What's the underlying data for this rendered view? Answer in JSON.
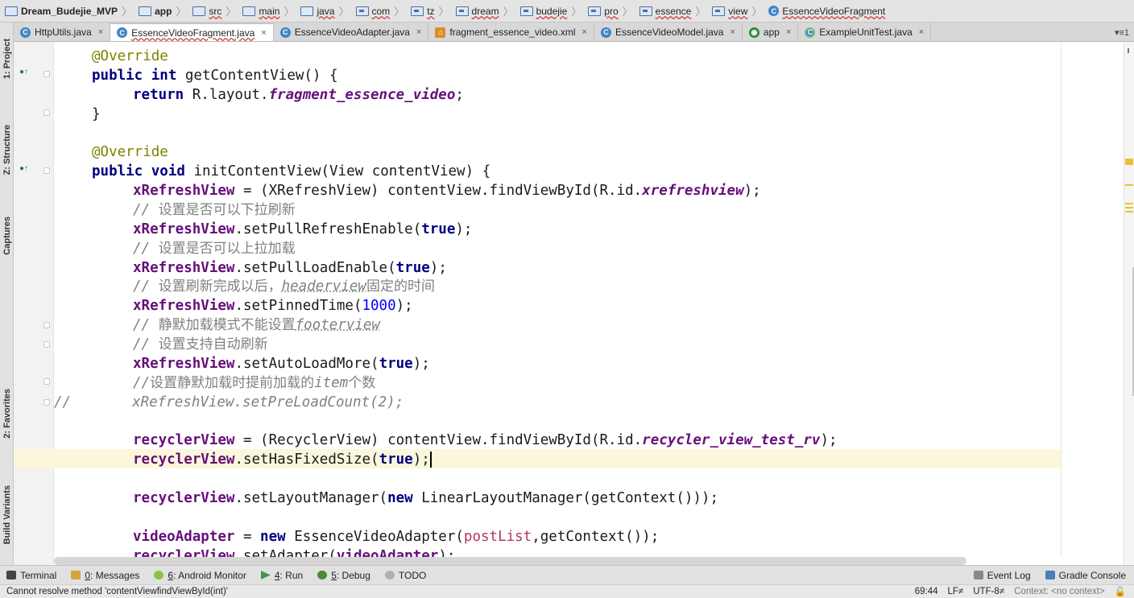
{
  "breadcrumbs": [
    "Dream_Budejie_MVP",
    "app",
    "src",
    "main",
    "java",
    "com",
    "tz",
    "dream",
    "budejie",
    "pro",
    "essence",
    "view",
    "EssenceVideoFragment"
  ],
  "tabs": [
    {
      "label": "HttpUtils.java",
      "icon": "class-icon"
    },
    {
      "label": "EssenceVideoFragment.java",
      "icon": "class-icon",
      "active": true
    },
    {
      "label": "EssenceVideoAdapter.java",
      "icon": "class-icon"
    },
    {
      "label": "fragment_essence_video.xml",
      "icon": "xml-icon"
    },
    {
      "label": "EssenceVideoModel.java",
      "icon": "class-icon"
    },
    {
      "label": "app",
      "icon": "android-app-icon"
    },
    {
      "label": "ExampleUnitTest.java",
      "icon": "test-class-icon"
    }
  ],
  "tab_close_glyph": "×",
  "tabs_overflow": "▾≡1",
  "left_tools": [
    "1: Project",
    "Z: Structure",
    "Captures",
    "2: Favorites",
    "Build Variants"
  ],
  "code": {
    "l1": "@Override",
    "l2a": "public int",
    "l2b": " getContentView() {",
    "l3a": "return",
    "l3b": " R.layout.",
    "l3c": "fragment_essence_video",
    "l3d": ";",
    "l4": "}",
    "l6": "@Override",
    "l7a": "public void",
    "l7b": " initContentView(View contentView) {",
    "l8a": "xRefreshView",
    "l8b": " = (XRefreshView) contentView.findViewById(R.id.",
    "l8c": "xrefreshview",
    "l8d": ");",
    "l9a": "// ",
    "l9b": "设置是否可以下拉刷新",
    "l10a": "xRefreshView",
    "l10b": ".setPullRefreshEnable(",
    "l10c": "true",
    "l10d": ");",
    "l11a": "// ",
    "l11b": "设置是否可以上拉加载",
    "l12a": "xRefreshView",
    "l12b": ".setPullLoadEnable(",
    "l12c": "true",
    "l12d": ");",
    "l13a": "// ",
    "l13b": "设置刷新完成以后，",
    "l13c": "headerview",
    "l13d": "固定的时间",
    "l14a": "xRefreshView",
    "l14b": ".setPinnedTime(",
    "l14c": "1000",
    "l14d": ");",
    "l15a": "// ",
    "l15b": "静默加载模式不能设置",
    "l15c": "footerview",
    "l16a": "// ",
    "l16b": "设置支持自动刷新",
    "l17a": "xRefreshView",
    "l17b": ".setAutoLoadMore(",
    "l17c": "true",
    "l17d": ");",
    "l18a": "//",
    "l18b": "设置静默加载时提前加载的",
    "l18c": "item",
    "l18d": "个数",
    "l19a": "//",
    "l19b": "xRefreshView.setPreLoadCount(2);",
    "l21a": "recyclerView",
    "l21b": " = (RecyclerView) contentView.findViewById(R.id.",
    "l21c": "recycler_view_test_rv",
    "l21d": ");",
    "l22a": "recyclerView",
    "l22b": ".setHasFixedSize(",
    "l22c": "true",
    "l22d": ");",
    "l24a": "recyclerView",
    "l24b": ".setLayoutManager(",
    "l24c": "new",
    "l24d": " LinearLayoutManager(getContext()));",
    "l26a": "videoAdapter",
    "l26b": " = ",
    "l26c": "new",
    "l26d": " EssenceVideoAdapter(",
    "l26e": "postList",
    "l26f": ",getContext());",
    "l27a": "recyclerView",
    "l27b": ".setAdapter(",
    "l27c": "videoAdapter",
    "l27d": ");"
  },
  "bottom_tools": [
    {
      "label": "Terminal"
    },
    {
      "mnemonic": "0",
      "label": ": Messages"
    },
    {
      "mnemonic": "6",
      "label": ": Android Monitor"
    },
    {
      "mnemonic": "4",
      "label": ": Run"
    },
    {
      "mnemonic": "5",
      "label": ": Debug"
    },
    {
      "label": "TODO"
    }
  ],
  "right_tools": [
    "Event Log",
    "Gradle Console"
  ],
  "status": {
    "message": "Cannot resolve method 'contentViewfindViewById(int)'",
    "position": "69:44",
    "line_sep": "LF≠",
    "encoding": "UTF-8≠",
    "context": "Context: <no context>"
  },
  "colors": {
    "keyword": "#000080",
    "field": "#660e7a",
    "annotation": "#808000",
    "comment": "#808080",
    "number": "#0000ff",
    "caret_line": "#fbf7dd"
  }
}
